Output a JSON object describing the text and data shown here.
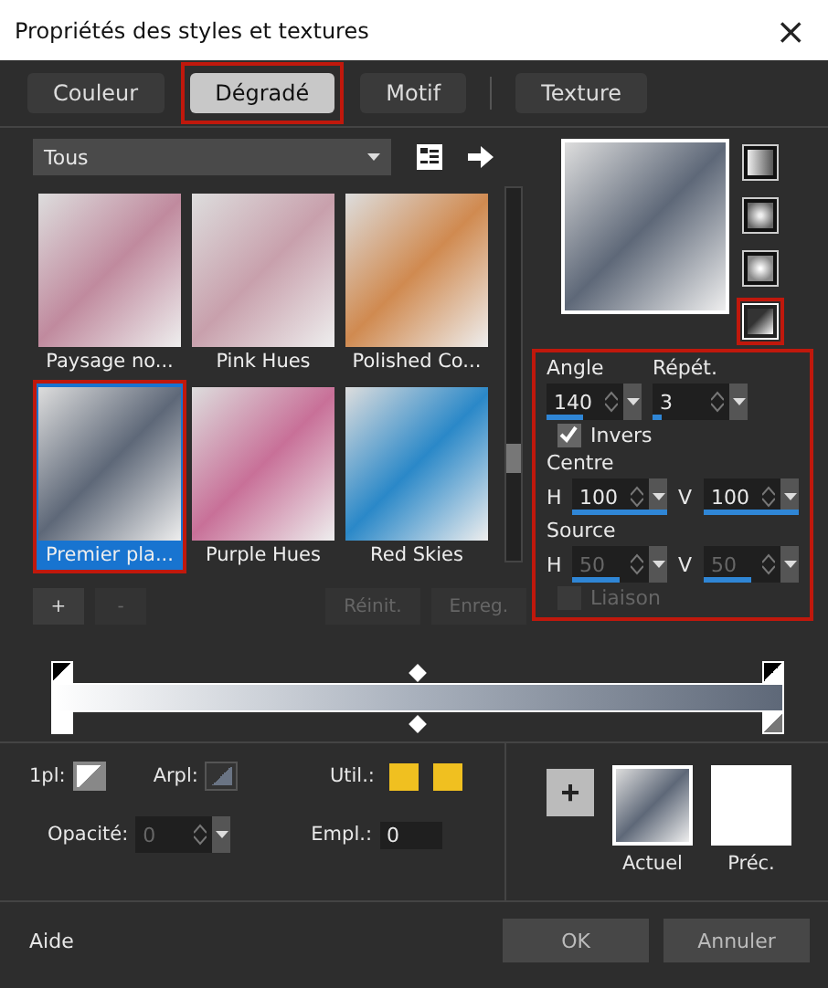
{
  "window": {
    "title": "Propriétés des styles et textures",
    "close": "×"
  },
  "tabs": [
    {
      "label": "Couleur",
      "selected": false,
      "highlighted": false
    },
    {
      "label": "Dégradé",
      "selected": true,
      "highlighted": true
    },
    {
      "label": "Motif",
      "selected": false,
      "highlighted": false
    },
    {
      "label": "Texture",
      "selected": false,
      "highlighted": false
    }
  ],
  "category": {
    "value": "Tous"
  },
  "presets": [
    {
      "label": "Paysage no...",
      "color": "#c08a9e",
      "selected": false,
      "highlighted": false
    },
    {
      "label": "Pink Hues",
      "color": "#c8a0ac",
      "selected": false,
      "highlighted": false
    },
    {
      "label": "Polished Co...",
      "color": "#d08a50",
      "selected": false,
      "highlighted": false
    },
    {
      "label": "Premier pla...",
      "color": "#5e6878",
      "selected": true,
      "highlighted": true
    },
    {
      "label": "Purple Hues",
      "color": "#c87098",
      "selected": false,
      "highlighted": false
    },
    {
      "label": "Red Skies",
      "color": "#2a88c8",
      "selected": false,
      "highlighted": false
    }
  ],
  "preset_buttons": [
    {
      "label": "+",
      "disabled": false
    },
    {
      "label": "-",
      "disabled": true
    },
    {
      "label": "Réinit.",
      "disabled": true
    },
    {
      "label": "Enreg.",
      "disabled": true
    }
  ],
  "styles": [
    {
      "kind": "linear",
      "selected": false,
      "highlighted": false
    },
    {
      "kind": "rectangular",
      "selected": false,
      "highlighted": false
    },
    {
      "kind": "radial",
      "selected": false,
      "highlighted": false
    },
    {
      "kind": "corner",
      "selected": true,
      "highlighted": true
    }
  ],
  "settings": {
    "highlighted": true,
    "angle": {
      "label": "Angle",
      "value": "140",
      "level": 0.39,
      "disabled": false
    },
    "repeat": {
      "label": "Répét.",
      "value": "3",
      "level": 0.1,
      "disabled": false
    },
    "invert": {
      "label": "Invers",
      "checked": true
    },
    "center": {
      "label": "Centre",
      "h_label": "H",
      "h": {
        "value": "100",
        "level": 1,
        "disabled": false
      },
      "v_label": "V",
      "v": {
        "value": "100",
        "level": 1,
        "disabled": false
      }
    },
    "source": {
      "label": "Source",
      "h_label": "H",
      "h": {
        "value": "50",
        "level": 0.5,
        "disabled": true
      },
      "v_label": "V",
      "v": {
        "value": "50",
        "level": 0.5,
        "disabled": true
      }
    },
    "link": {
      "label": "Liaison",
      "checked": false,
      "disabled": true
    }
  },
  "options": {
    "foreground_label": "1pl:",
    "background_label": "Arpl:",
    "used_label": "Util.:",
    "used_colors": [
      {
        "color": "#f0c020"
      },
      {
        "color": "#f0c020"
      }
    ],
    "opacity": {
      "label": "Opacité:",
      "value": "0",
      "disabled": true
    },
    "location": {
      "label": "Empl.:",
      "value": "0"
    }
  },
  "swatches": {
    "add": "+",
    "current": "Actuel",
    "previous": "Préc."
  },
  "footer": {
    "help": "Aide",
    "ok": "OK",
    "cancel": "Annuler"
  }
}
